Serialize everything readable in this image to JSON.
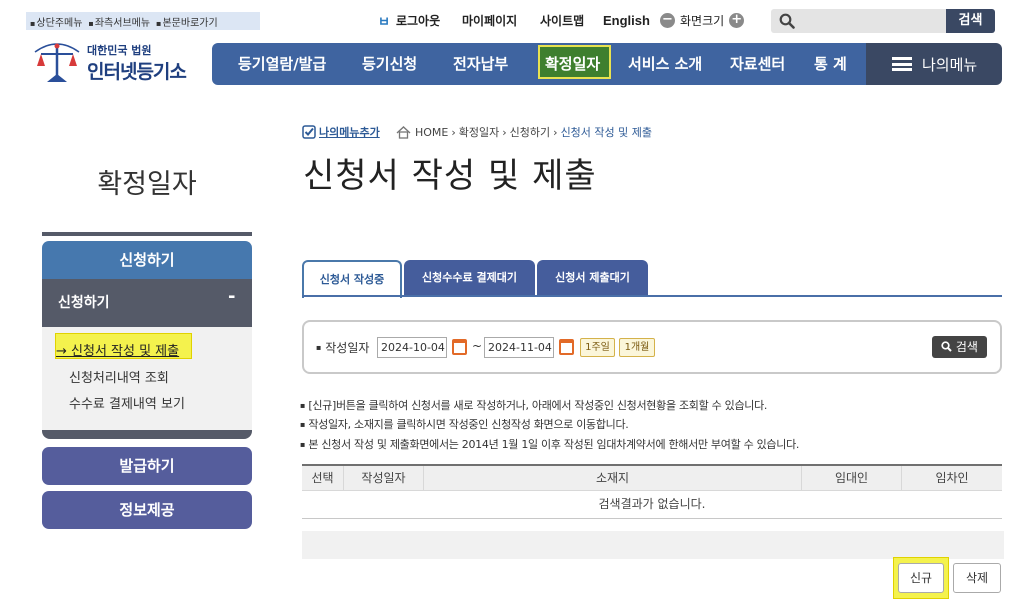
{
  "skip_links": [
    "상단주메뉴",
    "좌측서브메뉴",
    "본문바로가기"
  ],
  "utility": {
    "logout_icon": "ㅂ",
    "logout": "로그아웃",
    "mypage": "마이페이지",
    "sitemap": "사이트맵",
    "english": "English",
    "zoom_out": "−",
    "zoom_label": "화면크기",
    "zoom_in": "+",
    "search_button": "검색"
  },
  "logo": {
    "emblem_text": "대한민국법원",
    "line1": "대한민국 법원",
    "line2": "인터넷등기소"
  },
  "nav": {
    "items": [
      "등기열람/발급",
      "등기신청",
      "전자납부",
      "확정일자",
      "서비스 소개",
      "자료센터",
      "통 계"
    ],
    "active": "확정일자",
    "mymenu": "나의메뉴"
  },
  "sidebar": {
    "title": "확정일자",
    "section": "신청하기",
    "sub": "신청하기",
    "collapse": "-",
    "links": [
      "→ 신청서 작성 및 제출",
      "신청처리내역 조회",
      "수수료 결제내역 보기"
    ],
    "buttons": [
      "발급하기",
      "정보제공"
    ]
  },
  "breadcrumb": {
    "add_mymenu": "나의메뉴추가",
    "home": "HOME",
    "items": [
      "확정일자",
      "신청하기",
      "신청서 작성 및 제출"
    ],
    "separator": "›"
  },
  "page_title": "신청서 작성 및 제출",
  "tabs": [
    "신청서 작성중",
    "신청수수료 결제대기",
    "신청서 제출대기"
  ],
  "search": {
    "label": "작성일자",
    "from": "2024-10-04",
    "tilde": "~",
    "to": "2024-11-04",
    "period_buttons": [
      "1주일",
      "1개월"
    ],
    "button": "검색"
  },
  "notices": [
    "[신규]버튼을 클릭하여 신청서를 새로 작성하거나, 아래에서 작성중인 신청서현황을 조회할 수 있습니다.",
    "작성일자, 소재지를 클릭하시면 작성중인 신청작성 화면으로 이동합니다.",
    "본 신청서 작성 및 제출화면에서는 2014년 1월 1일 이후 작성된 임대차계약서에 한해서만 부여할 수 있습니다."
  ],
  "table": {
    "headers": [
      "선택",
      "작성일자",
      "소재지",
      "임대인",
      "임차인"
    ],
    "empty_message": "검색결과가 없습니다."
  },
  "actions": {
    "new": "신규",
    "delete": "삭제"
  },
  "colors": {
    "nav_blue": "#3f64a0",
    "nav_active_green": "#3e7f2e",
    "highlight_yellow": "#f4f24d",
    "dark_navy": "#3a4863"
  }
}
